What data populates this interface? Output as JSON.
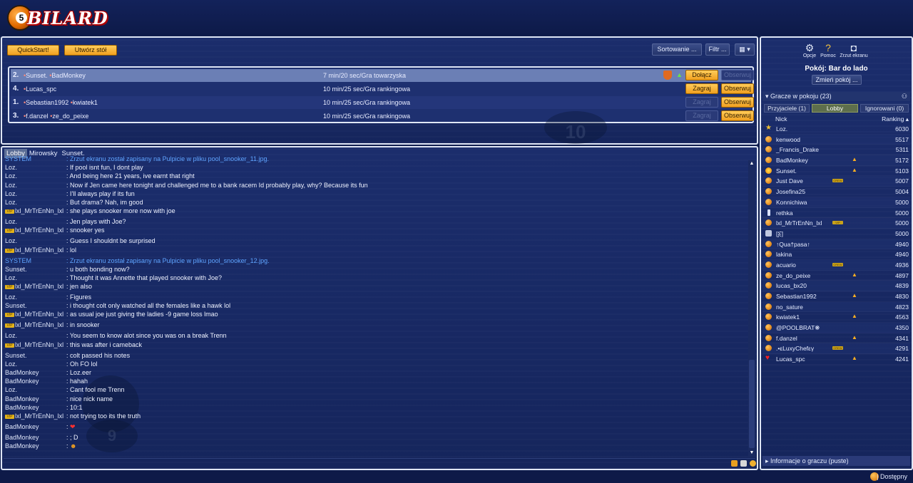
{
  "app": {
    "logo_number": "5",
    "logo_text": "BILARD"
  },
  "toolbar": {
    "quickstart": "QuickStart!",
    "create_table": "Utwórz stół",
    "sort": "Sortowanie ...",
    "filter": "Filtr ..."
  },
  "tables": [
    {
      "num": "2.",
      "players": [
        "Sunset.",
        "BadMonkey"
      ],
      "info": "7 min/20 sec/Gra towarzyska",
      "btn1": "Dołącz",
      "btn1_enabled": true,
      "btn2": "Obserwuj",
      "btn2_enabled": false
    },
    {
      "num": "4.",
      "players": [
        "Lucas_spc"
      ],
      "info": "10 min/25 sec/Gra rankingowa",
      "btn1": "Zagraj",
      "btn1_enabled": true,
      "btn2": "Obserwuj",
      "btn2_enabled": true
    },
    {
      "num": "1.",
      "players": [
        "Sebastian1992",
        "kwiatek1"
      ],
      "info": "10 min/25 sec/Gra rankingowa",
      "btn1": "Zagraj",
      "btn1_enabled": false,
      "btn2": "Obserwuj",
      "btn2_enabled": true
    },
    {
      "num": "3.",
      "players": [
        "f.danzel",
        "ze_do_peixe"
      ],
      "info": "10 min/25 sec/Gra rankingowa",
      "btn1": "Zagraj",
      "btn1_enabled": false,
      "btn2": "Obserwuj",
      "btn2_enabled": true
    }
  ],
  "chat": {
    "tabs": [
      "Lobby",
      "Mirowsky",
      "Sunset."
    ],
    "lines": [
      {
        "who": "SYSTEM",
        "msg": "Zrzut ekranu został zapisany na Pulpicie w pliku pool_snooker_11.jpg.",
        "sys": true
      },
      {
        "who": "Loz.",
        "msg": "If pool isnt fun, I dont play"
      },
      {
        "who": "Loz.",
        "msg": "And being here 21 years, ive earnt that right"
      },
      {
        "who": "Loz.",
        "msg": "Now if Jen came here tonight and challenged me to a bank racem Id probably play, why? Because its fun"
      },
      {
        "who": "Loz.",
        "msg": "I'll always play if its fun"
      },
      {
        "who": "Loz.",
        "msg": "But drama? Nah, im good"
      },
      {
        "who": "lxl_MrTrEnNn_lxl",
        "msg": "she plays snooker more now with joe",
        "vip": true
      },
      {
        "who": "Loz.",
        "msg": "Jen plays with Joe?"
      },
      {
        "who": "lxl_MrTrEnNn_lxl",
        "msg": "snooker yes",
        "vip": true
      },
      {
        "who": "Loz.",
        "msg": "Guess I shouldnt be surprised"
      },
      {
        "who": "lxl_MrTrEnNn_lxl",
        "msg": "lol",
        "vip": true
      },
      {
        "who": "SYSTEM",
        "msg": "Zrzut ekranu został zapisany na Pulpicie w pliku pool_snooker_12.jpg.",
        "sys": true
      },
      {
        "who": "Sunset.",
        "msg": "u both bonding now?"
      },
      {
        "who": "Loz.",
        "msg": "Thought it was Annette that played snooker with Joe?"
      },
      {
        "who": "lxl_MrTrEnNn_lxl",
        "msg": "jen also",
        "vip": true
      },
      {
        "who": "Loz.",
        "msg": "Figures"
      },
      {
        "who": "Sunset.",
        "msg": "i thought colt only watched all the females like a hawk lol"
      },
      {
        "who": "lxl_MrTrEnNn_lxl",
        "msg": "as usual joe just giving the ladies -9 game loss lmao",
        "vip": true
      },
      {
        "who": "lxl_MrTrEnNn_lxl",
        "msg": "in snooker",
        "vip": true
      },
      {
        "who": "Loz.",
        "msg": "You seem to know alot since you was on a break Trenn"
      },
      {
        "who": "lxl_MrTrEnNn_lxl",
        "msg": "this was after i cameback",
        "vip": true
      },
      {
        "who": "Sunset.",
        "msg": "colt passed his notes"
      },
      {
        "who": "Loz.",
        "msg": "Oh FO lol"
      },
      {
        "who": "BadMonkey",
        "msg": "Loz.eer"
      },
      {
        "who": "BadMonkey",
        "msg": "hahah"
      },
      {
        "who": "Loz.",
        "msg": "Cant fool me Trenn"
      },
      {
        "who": "BadMonkey",
        "msg": "nice nick name"
      },
      {
        "who": "BadMonkey",
        "msg": "10:1"
      },
      {
        "who": "lxl_MrTrEnNn_lxl",
        "msg": "not trying too its the truth",
        "vip": true
      },
      {
        "who": "BadMonkey",
        "msg": "❤",
        "emoji": true
      },
      {
        "who": "BadMonkey",
        "msg": "; D"
      },
      {
        "who": "BadMonkey",
        "msg": "☻",
        "emoji": true
      }
    ]
  },
  "side": {
    "options": "Opcje",
    "help": "Pomoc",
    "screenshot": "Zrzut ekranu",
    "room_title": "Pokój: Bar do lado",
    "change_room": "Zmień pokój ...",
    "players_header": "Gracze w pokoju (23)",
    "tabs": [
      "Przyjaciele (1)",
      "Lobby",
      "Ignorowani (0)"
    ],
    "col_nick": "Nick",
    "col_rank": "Ranking ▴",
    "players": [
      {
        "nick": "Loz.",
        "rank": "6030",
        "icon": "star"
      },
      {
        "nick": "kenwood",
        "rank": "5517"
      },
      {
        "nick": "_Francis_Drake",
        "rank": "5311"
      },
      {
        "nick": "BadMonkey",
        "rank": "5172",
        "bell": true
      },
      {
        "nick": "Sunset.",
        "rank": "5103",
        "bell": true,
        "icon": "sun"
      },
      {
        "nick": "Just Dave",
        "rank": "5007",
        "badge": "CREW"
      },
      {
        "nick": "Josefina25",
        "rank": "5004"
      },
      {
        "nick": "Konnichiwa",
        "rank": "5000"
      },
      {
        "nick": "rethka",
        "rank": "5000",
        "icon": "candle"
      },
      {
        "nick": "lxl_MrTrEnNn_lxl",
        "rank": "5000",
        "badge": "VIP"
      },
      {
        "nick": "[፩]",
        "rank": "5000",
        "icon": "lock"
      },
      {
        "nick": "↑Qua†pasa↑",
        "rank": "4940"
      },
      {
        "nick": "lakina",
        "rank": "4940"
      },
      {
        "nick": "acuario",
        "rank": "4936",
        "badge": "CREW"
      },
      {
        "nick": "ze_do_peixe",
        "rank": "4897",
        "bell": true
      },
      {
        "nick": "lucas_bx20",
        "rank": "4839"
      },
      {
        "nick": "Sebastian1992",
        "rank": "4830",
        "bell": true
      },
      {
        "nick": "no_sature",
        "rank": "4823"
      },
      {
        "nick": "kwiatek1",
        "rank": "4563",
        "bell": true
      },
      {
        "nick": "@POOLBRAT❋",
        "rank": "4350"
      },
      {
        "nick": "f.danzel",
        "rank": "4341",
        "bell": true
      },
      {
        "nick": ".•εLuxyChefεγ",
        "rank": "4291",
        "badge": "CREW"
      },
      {
        "nick": "Lucas_spc",
        "rank": "4241",
        "bell": true,
        "icon": "heart"
      }
    ],
    "info_bar": "Informacje o graczu (puste)"
  },
  "status": {
    "text": "Dostępny"
  },
  "colors": {
    "accent_orange": "#f0a020",
    "panel_bg": "#1b2d6c",
    "system_text": "#5fa4ff"
  }
}
